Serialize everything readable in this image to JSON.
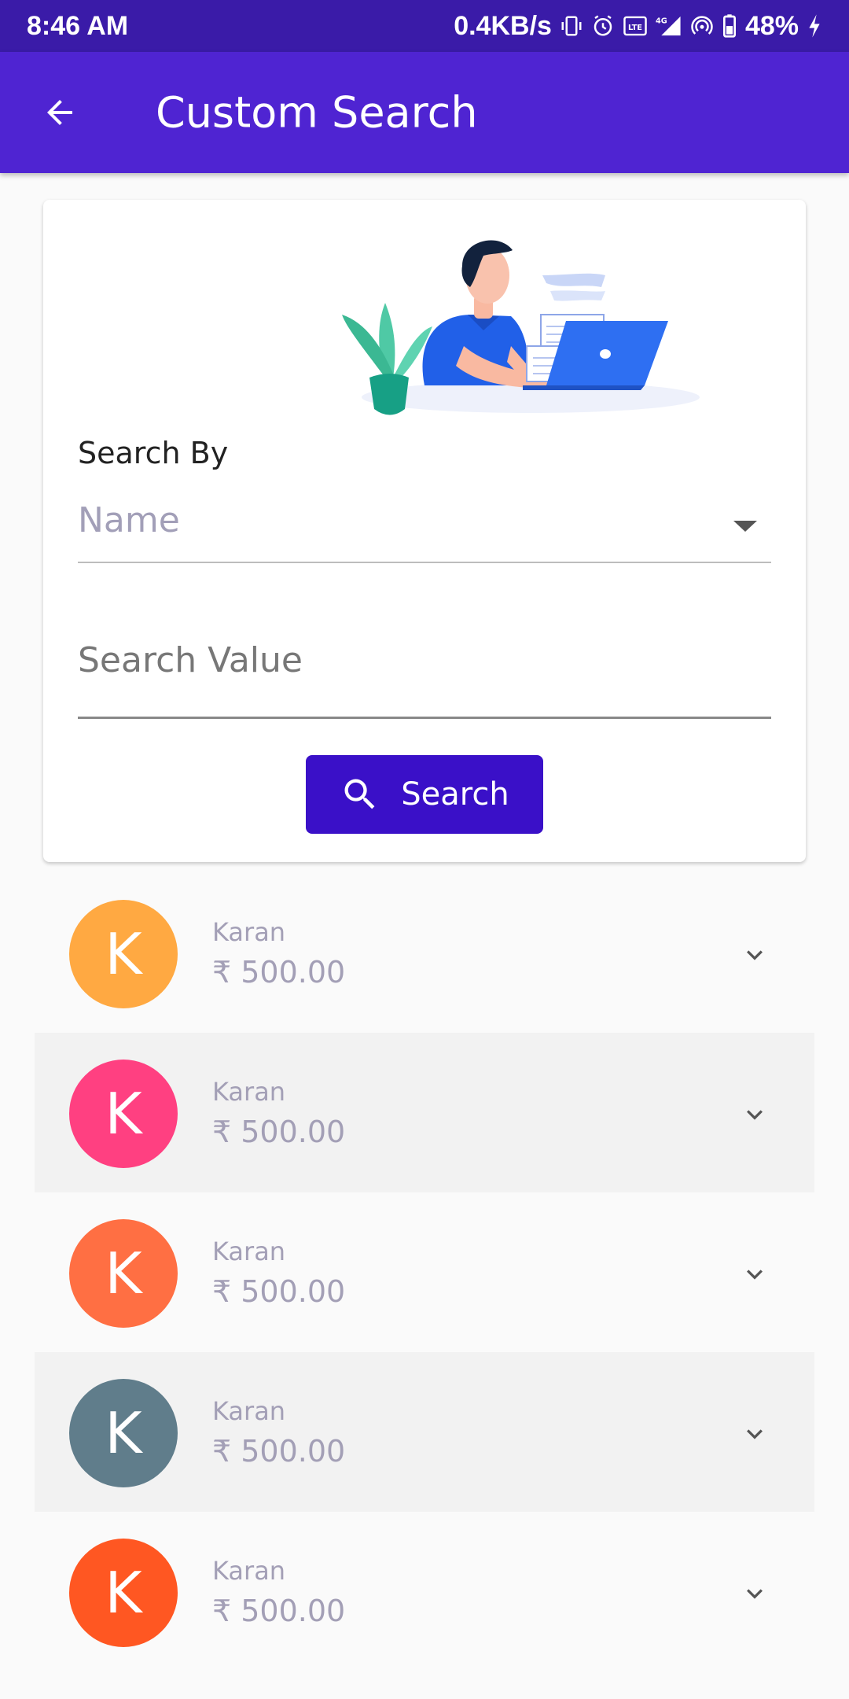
{
  "status_bar": {
    "time": "8:46 AM",
    "speed": "0.4KB/s",
    "network": "4G",
    "battery": "48%"
  },
  "app_bar": {
    "title": "Custom Search"
  },
  "form": {
    "search_by_label": "Search By",
    "search_by_value": "Name",
    "search_value_placeholder": "Search Value",
    "search_value": "",
    "search_button_label": "Search"
  },
  "results": [
    {
      "initial": "K",
      "name": "Karan",
      "amount": "₹ 500.00",
      "color": "#ffa942"
    },
    {
      "initial": "K",
      "name": "Karan",
      "amount": "₹ 500.00",
      "color": "#ff4081"
    },
    {
      "initial": "K",
      "name": "Karan",
      "amount": "₹ 500.00",
      "color": "#ff6f43"
    },
    {
      "initial": "K",
      "name": "Karan",
      "amount": "₹ 500.00",
      "color": "#607d8b"
    },
    {
      "initial": "K",
      "name": "Karan",
      "amount": "₹ 500.00",
      "color": "#ff5722"
    }
  ],
  "colors": {
    "status_bar": "#3a1ba8",
    "app_bar": "#4f24d2",
    "button": "#3a10c8"
  }
}
